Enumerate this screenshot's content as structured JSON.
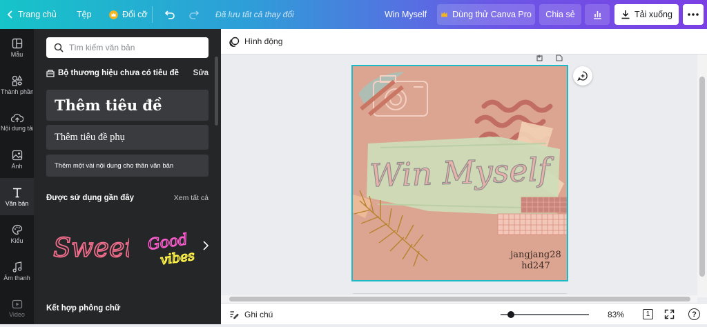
{
  "topbar": {
    "home_label": "Trang chủ",
    "file_label": "Tệp",
    "resize_label": "Đổi cỡ",
    "save_status": "Đã lưu tất cả thay đổi",
    "design_title": "Win Myself",
    "pro_label": "Dùng thử Canva Pro",
    "share_label": "Chia sẻ",
    "download_label": "Tải xuống"
  },
  "rail": {
    "items": [
      {
        "label": "Mẫu",
        "icon": "template-icon"
      },
      {
        "label": "Thành phần",
        "icon": "elements-icon"
      },
      {
        "label": "Nội dung tải lên",
        "icon": "upload-icon"
      },
      {
        "label": "Ảnh",
        "icon": "photo-icon"
      },
      {
        "label": "Văn bản",
        "icon": "text-icon"
      },
      {
        "label": "Kiểu",
        "icon": "styles-icon"
      },
      {
        "label": "Âm thanh",
        "icon": "audio-icon"
      },
      {
        "label": "Video",
        "icon": "video-icon"
      }
    ]
  },
  "panel": {
    "search_placeholder": "Tìm kiếm văn bản",
    "brand_kit": "Bộ thương hiệu chưa có tiêu đề",
    "edit_label": "Sửa",
    "add_heading": "Thêm tiêu đề",
    "add_subheading": "Thêm tiêu đề phụ",
    "add_body": "Thêm một vài nội dung cho thân văn bản",
    "recent_title": "Được sử dụng gần đây",
    "see_all": "Xem tất cả",
    "recent_items": [
      "Sweet",
      "Good",
      "vibes"
    ],
    "font_combos_title": "Kết hợp phông chữ"
  },
  "canvas": {
    "animate_label": "Hình động",
    "design_text": "Win Myself",
    "author_line1": "jangjang28",
    "author_line2": "hd247",
    "notes_label": "Ghi chú",
    "zoom": "83%",
    "page_count": "1",
    "zoom_slider_percent": 12
  },
  "colors": {
    "accent": "#1bb8c8",
    "page_bg": "#dca591",
    "panel_bg": "#252627",
    "rail_bg": "#18191b"
  }
}
